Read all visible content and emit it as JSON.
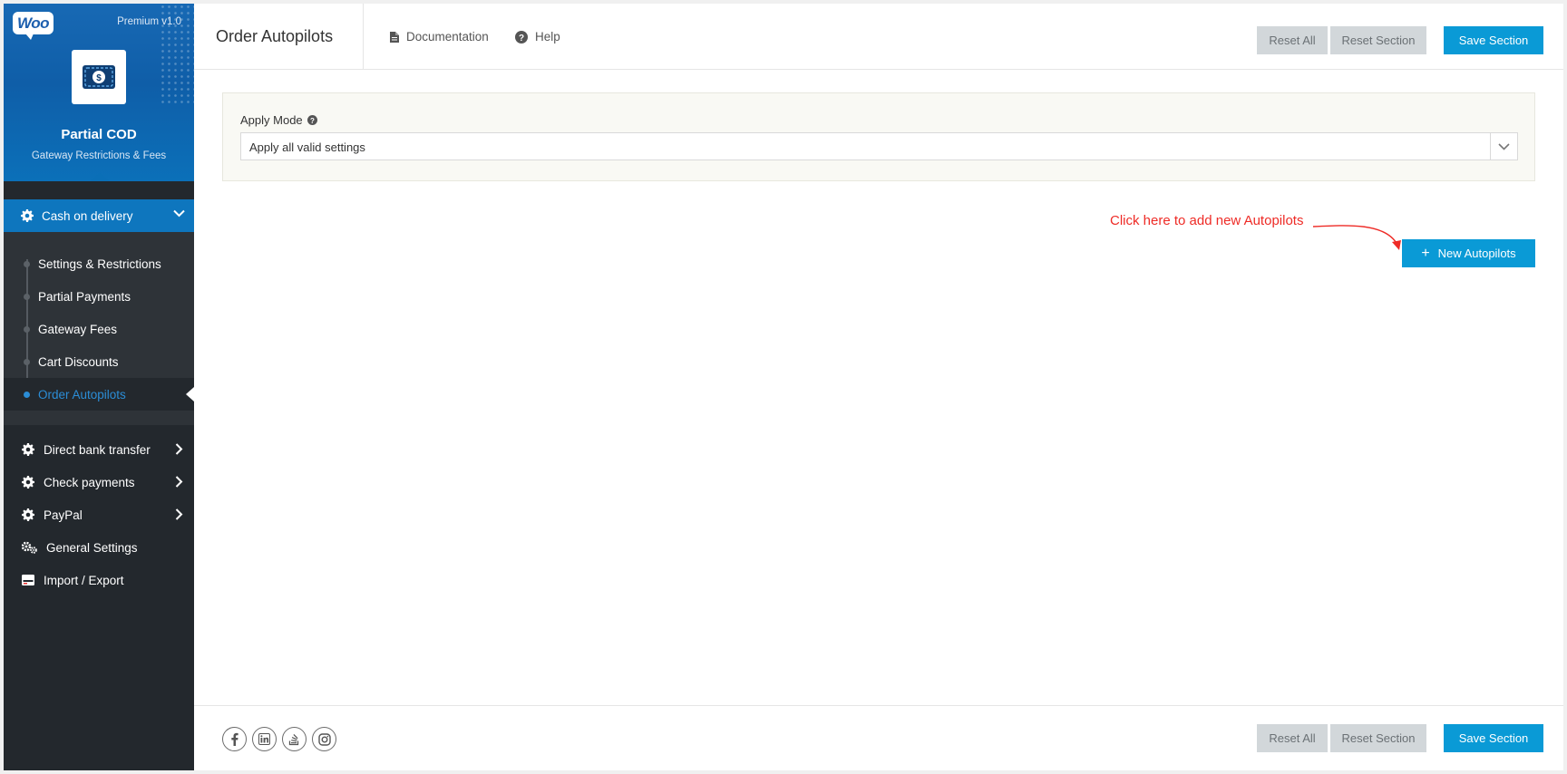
{
  "brand": {
    "logo_text": "Woo",
    "version": "Premium v1.0",
    "plugin_title": "Partial COD",
    "plugin_subtitle": "Gateway Restrictions & Fees"
  },
  "sidebar": {
    "active_section": {
      "label": "Cash on delivery",
      "icon": "gear-icon"
    },
    "sub_items": [
      {
        "label": "Settings & Restrictions"
      },
      {
        "label": "Partial Payments"
      },
      {
        "label": "Gateway Fees"
      },
      {
        "label": "Cart Discounts"
      },
      {
        "label": "Order Autopilots",
        "active": true
      }
    ],
    "items": [
      {
        "label": "Direct bank transfer",
        "icon": "gear-icon",
        "expandable": true
      },
      {
        "label": "Check payments",
        "icon": "gear-icon",
        "expandable": true
      },
      {
        "label": "PayPal",
        "icon": "gear-icon",
        "expandable": true
      },
      {
        "label": "General Settings",
        "icon": "gears-icon",
        "expandable": false
      },
      {
        "label": "Import / Export",
        "icon": "import-export-icon",
        "expandable": false
      }
    ]
  },
  "header": {
    "title": "Order Autopilots",
    "documentation": "Documentation",
    "help": "Help",
    "reset_all": "Reset All",
    "reset_section": "Reset Section",
    "save_section": "Save Section"
  },
  "apply_mode": {
    "label": "Apply Mode",
    "selected": "Apply all valid settings"
  },
  "annotation": "Click here to add new Autopilots",
  "new_button": {
    "plus": "+",
    "label": "New Autopilots"
  },
  "footer": {
    "social": [
      "facebook-icon",
      "linkedin-icon",
      "stackoverflow-icon",
      "instagram-icon"
    ],
    "reset_all": "Reset All",
    "reset_section": "Reset Section",
    "save_section": "Save Section"
  },
  "colors": {
    "accent": "#0a9ad6",
    "sidebar_bg": "#23282d",
    "active_nav": "#0e76be",
    "annotation": "#ee2b26",
    "grey_button": "#d2d7da"
  }
}
